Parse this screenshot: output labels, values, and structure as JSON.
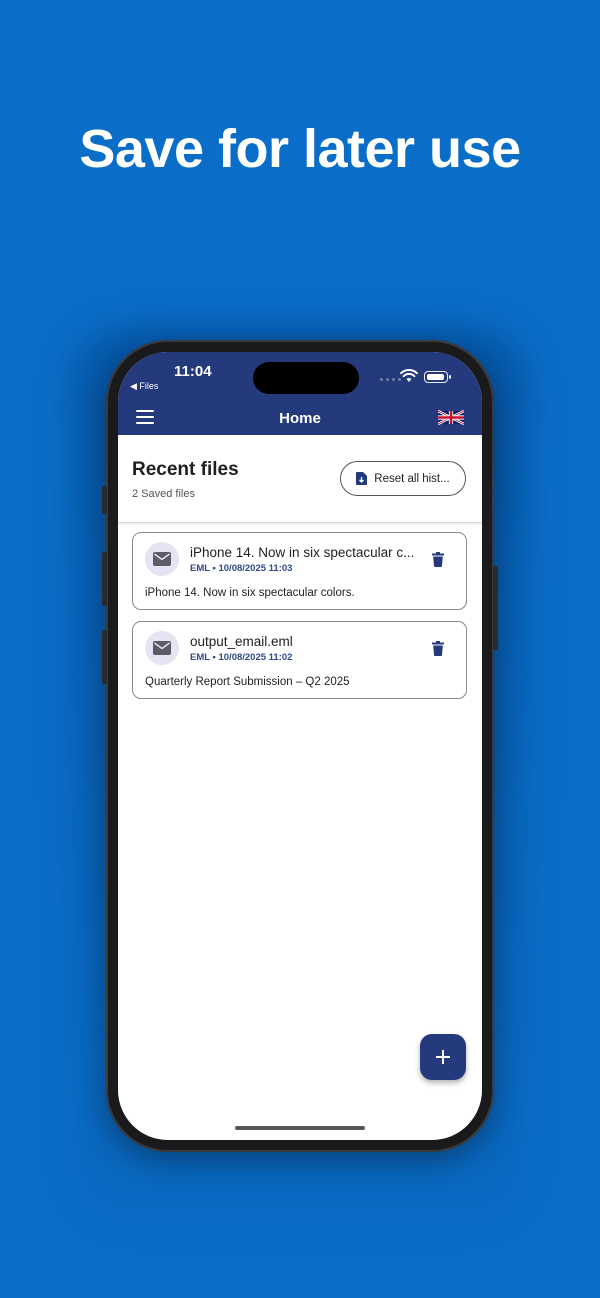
{
  "headline": "Save for later use",
  "status": {
    "time": "11:04",
    "back_label": "◀ Files"
  },
  "header": {
    "title": "Home",
    "menu_icon": "hamburger-menu-icon",
    "language_icon": "uk-flag-icon"
  },
  "recent": {
    "title": "Recent files",
    "count_label": "2 Saved files",
    "reset_label": "Reset all hist..."
  },
  "files": [
    {
      "title": "iPhone 14. Now in six spectacular c...",
      "meta": "EML • 10/08/2025 11:03",
      "description": "iPhone 14. Now in six spectacular colors."
    },
    {
      "title": "output_email.eml",
      "meta": "EML • 10/08/2025 11:02",
      "description": "Quarterly Report Submission – Q2 2025"
    }
  ],
  "colors": {
    "background": "#0a6ec8",
    "app_bar": "#243a7c",
    "accent_text": "#2d4a8e"
  }
}
